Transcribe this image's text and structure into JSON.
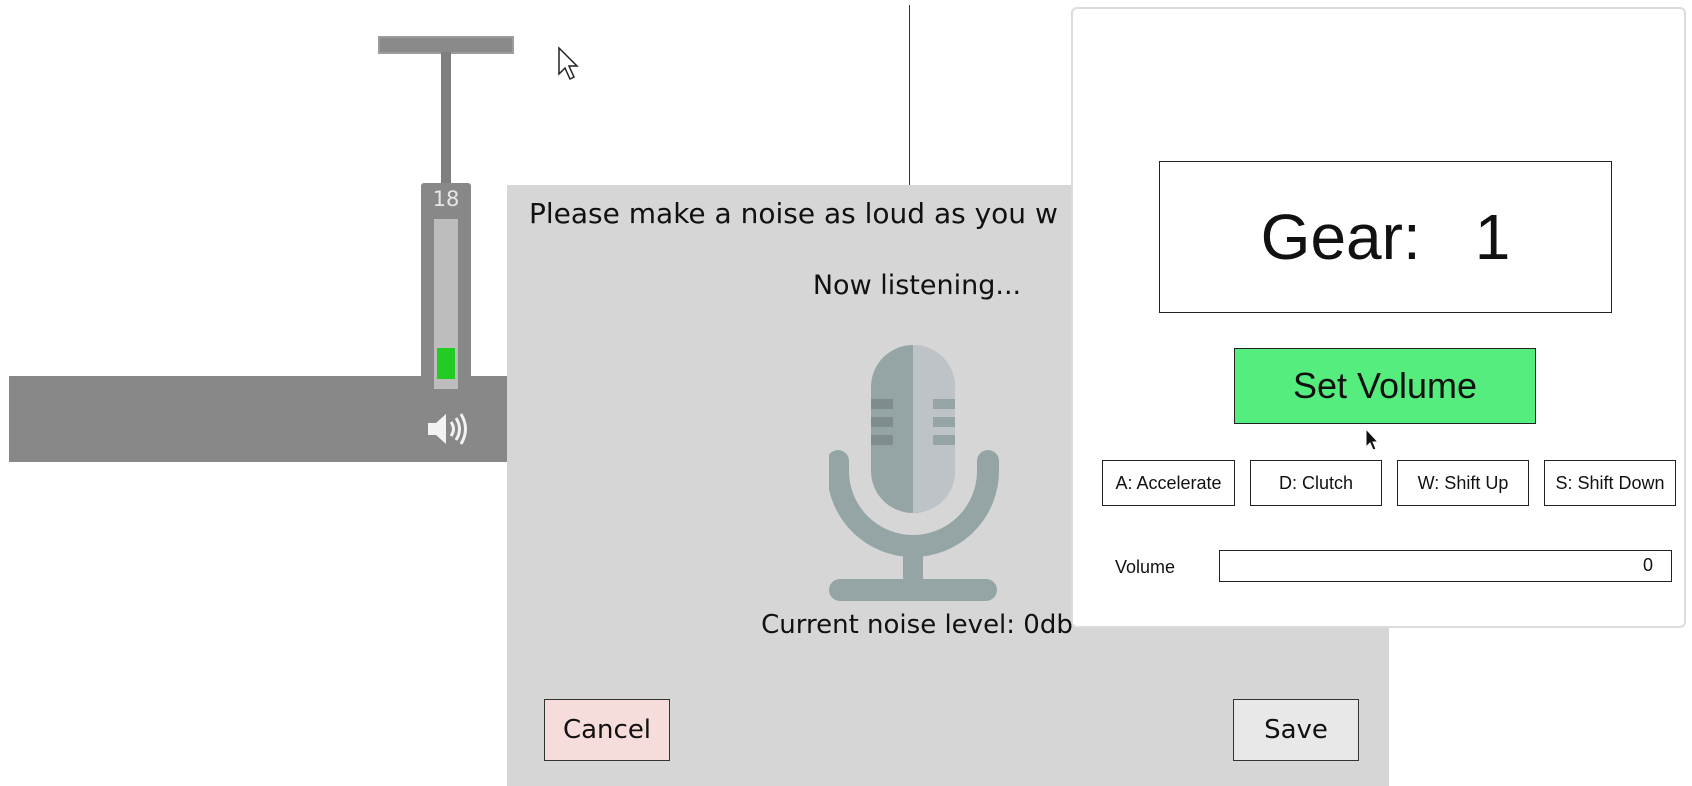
{
  "background": {
    "volume_meter": {
      "value_label": "18",
      "level_fraction": 0.18
    },
    "icons": [
      "speaker-icon",
      "mouse-cursor-icon"
    ]
  },
  "dialog": {
    "prompt": "Please make a noise as loud as you w",
    "status": "Now listening...",
    "noise_level": "Current noise level: 0db",
    "cancel_label": "Cancel",
    "save_label": "Save",
    "icon": "microphone-icon"
  },
  "game_panel": {
    "gear_label": "Gear:",
    "gear_value": "1",
    "set_volume_label": "Set Volume",
    "keys": {
      "accelerate": "A: Accelerate",
      "clutch": "D: Clutch",
      "shift_up": "W: Shift Up",
      "shift_down": "S: Shift Down"
    },
    "volume_label": "Volume",
    "volume_value": "0"
  },
  "colors": {
    "set_volume_bg": "#55ee7e",
    "cancel_bg": "#f7dcdc",
    "dialog_bg": "#d6d6d6",
    "meter_fill": "#22cc22"
  }
}
